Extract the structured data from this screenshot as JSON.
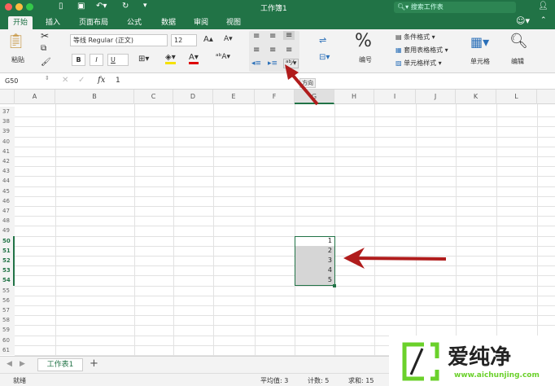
{
  "window": {
    "title": "工作簿1",
    "search_placeholder": "搜索工作表"
  },
  "tabs": [
    "开始",
    "插入",
    "页面布局",
    "公式",
    "数据",
    "审阅",
    "视图"
  ],
  "ribbon": {
    "paste": "粘贴",
    "font_name": "等线 Regular (正文)",
    "font_size": "12",
    "bold": "B",
    "italic": "I",
    "underline": "U",
    "number_label": "编号",
    "percent": "%",
    "cond_format": "条件格式",
    "table_format": "套用表格格式",
    "cell_style": "单元格样式",
    "cells": "单元格",
    "edit": "编辑",
    "tooltip": "方向"
  },
  "formula_bar": {
    "name_box": "G50",
    "fx": "fx",
    "value": "1"
  },
  "columns": [
    "A",
    "B",
    "C",
    "D",
    "E",
    "F",
    "G",
    "H",
    "I",
    "J",
    "K",
    "L"
  ],
  "rows": [
    "37",
    "38",
    "39",
    "40",
    "41",
    "42",
    "43",
    "44",
    "45",
    "46",
    "47",
    "48",
    "49",
    "50",
    "51",
    "52",
    "53",
    "54",
    "55",
    "56",
    "57",
    "58",
    "59",
    "60",
    "61"
  ],
  "selected_values": [
    "1",
    "2",
    "3",
    "4",
    "5"
  ],
  "sheet_tab": "工作表1",
  "add_sheet": "+",
  "status": {
    "ready": "就绪",
    "average": "平均值: 3",
    "count": "计数: 5",
    "sum": "求和: 15"
  },
  "watermark": {
    "brand": "爱纯净",
    "url": "www.aichunjing.com"
  },
  "colors": {
    "accent": "#217346",
    "arrow": "#b01c1c"
  }
}
